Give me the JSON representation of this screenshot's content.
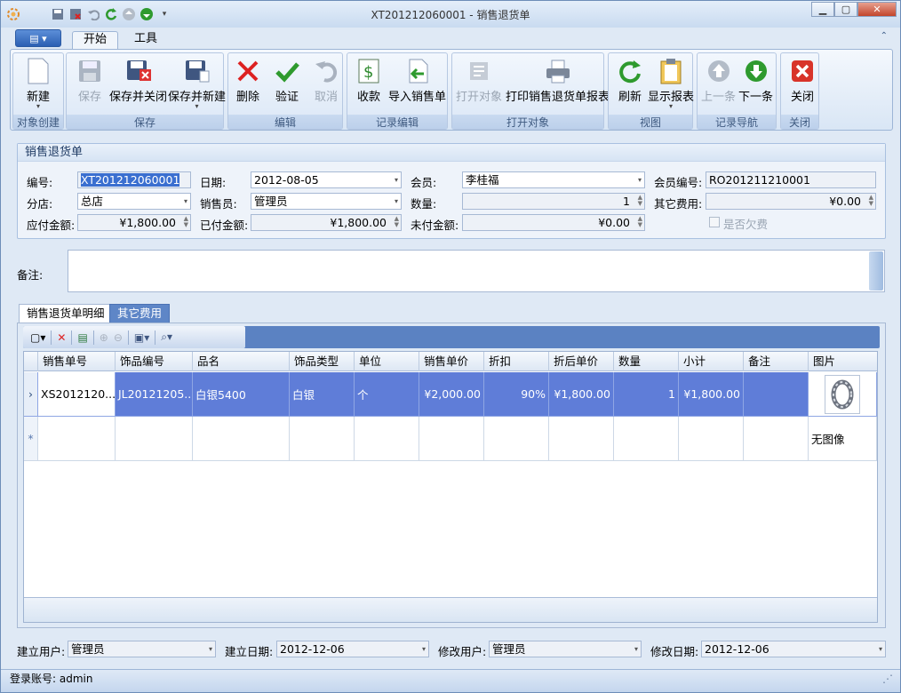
{
  "window": {
    "title": "XT201212060001 - 销售退货单"
  },
  "ribbon": {
    "tabs": [
      "开始",
      "工具"
    ],
    "groups": [
      {
        "label": "对象创建",
        "buttons": [
          "新建"
        ]
      },
      {
        "label": "保存",
        "buttons": [
          "保存",
          "保存并关闭",
          "保存并新建"
        ]
      },
      {
        "label": "编辑",
        "buttons": [
          "删除",
          "验证",
          "取消"
        ]
      },
      {
        "label": "记录编辑",
        "buttons": [
          "收款",
          "导入销售单"
        ]
      },
      {
        "label": "打开对象",
        "buttons": [
          "打开对象",
          "打印销售退货单报表"
        ]
      },
      {
        "label": "视图",
        "buttons": [
          "刷新",
          "显示报表"
        ]
      },
      {
        "label": "记录导航",
        "buttons": [
          "上一条",
          "下一条"
        ]
      },
      {
        "label": "关闭",
        "buttons": [
          "关闭"
        ]
      }
    ]
  },
  "form": {
    "section_title": "销售退货单",
    "labels": {
      "code": "编号:",
      "date": "日期:",
      "member": "会员:",
      "member_code": "会员编号:",
      "store": "分店:",
      "salesperson": "销售员:",
      "quantity": "数量:",
      "other_fee": "其它费用:",
      "payable": "应付金额:",
      "paid": "已付金额:",
      "unpaid": "未付金额:",
      "owing": "是否欠费"
    },
    "values": {
      "code": "XT201212060001",
      "date": "2012-08-05",
      "member": "李桂福",
      "member_code": "RO201211210001",
      "store": "总店",
      "salesperson": "管理员",
      "quantity": "1",
      "other_fee": "¥0.00",
      "payable": "¥1,800.00",
      "paid": "¥1,800.00",
      "unpaid": "¥0.00"
    },
    "memo_label": "备注:"
  },
  "detail": {
    "tabs": [
      "销售退货单明细",
      "其它费用"
    ],
    "columns": [
      "销售单号",
      "饰品编号",
      "品名",
      "饰品类型",
      "单位",
      "销售单价",
      "折扣",
      "折后单价",
      "数量",
      "小计",
      "备注",
      "图片"
    ],
    "rows": [
      {
        "order_no": "XS2012120...",
        "item_no": "JL20121205...",
        "name": "白银5400",
        "type": "白银",
        "unit": "个",
        "price": "¥2,000.00",
        "discount": "90%",
        "net_price": "¥1,800.00",
        "qty": "1",
        "subtotal": "¥1,800.00",
        "note": "",
        "image": "ring-image"
      }
    ],
    "new_row": {
      "image_text": "无图像"
    }
  },
  "footer": {
    "labels": {
      "created_by": "建立用户:",
      "created_date": "建立日期:",
      "modified_by": "修改用户:",
      "modified_date": "修改日期:"
    },
    "values": {
      "created_by": "管理员",
      "created_date": "2012-12-06",
      "modified_by": "管理员",
      "modified_date": "2012-12-06"
    }
  },
  "status": {
    "login": "登录账号: admin"
  },
  "colors": {
    "selected_row": "#5f7dd8",
    "grid_toolbar": "#5b82c2",
    "title_accent": "#2b5fb3"
  }
}
